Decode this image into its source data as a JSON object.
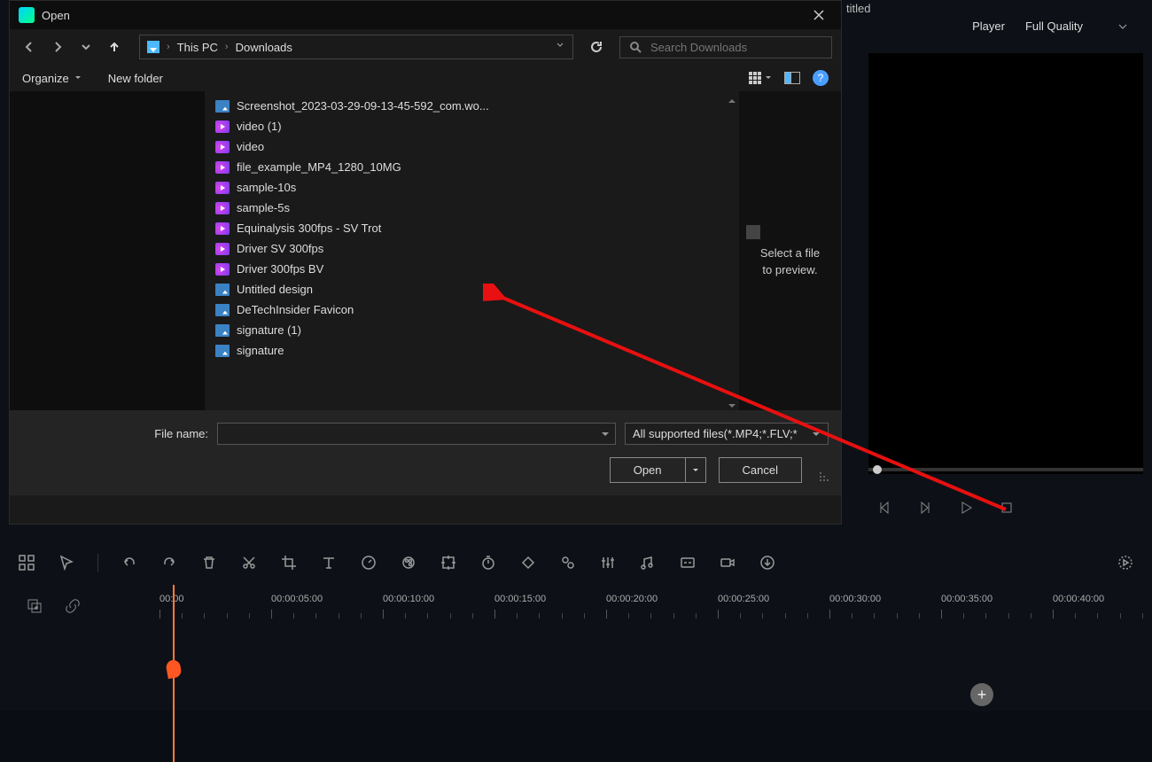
{
  "background": {
    "titled": "titled",
    "player_label": "Player",
    "quality": "Full Quality"
  },
  "dialog": {
    "title": "Open",
    "breadcrumb": {
      "pc": "This PC",
      "folder": "Downloads"
    },
    "search_placeholder": "Search Downloads",
    "organize": "Organize",
    "new_folder": "New folder",
    "help": "?",
    "preview": {
      "l1": "Select a file",
      "l2": "to preview."
    },
    "filename_label": "File name:",
    "filetype": "All supported files(*.MP4;*.FLV;*",
    "open_btn": "Open",
    "cancel_btn": "Cancel",
    "files": [
      {
        "icon": "img",
        "name": "Screenshot_2023-03-29-09-13-45-592_com.wo..."
      },
      {
        "icon": "vid",
        "name": "video (1)"
      },
      {
        "icon": "vid",
        "name": "video"
      },
      {
        "icon": "vid",
        "name": "file_example_MP4_1280_10MG"
      },
      {
        "icon": "vid",
        "name": "sample-10s"
      },
      {
        "icon": "vid",
        "name": "sample-5s"
      },
      {
        "icon": "vid",
        "name": "Equinalysis 300fps - SV Trot"
      },
      {
        "icon": "vid",
        "name": "Driver SV 300fps"
      },
      {
        "icon": "vid",
        "name": "Driver 300fps BV"
      },
      {
        "icon": "img",
        "name": "Untitled design"
      },
      {
        "icon": "img",
        "name": "DeTechInsider Favicon"
      },
      {
        "icon": "img",
        "name": "signature (1)"
      },
      {
        "icon": "img",
        "name": "signature"
      }
    ]
  },
  "timeline": {
    "ticks": [
      "00:00",
      "00:00:05:00",
      "00:00:10:00",
      "00:00:15:00",
      "00:00:20:00",
      "00:00:25:00",
      "00:00:30:00",
      "00:00:35:00",
      "00:00:40:00",
      "00:00"
    ]
  }
}
